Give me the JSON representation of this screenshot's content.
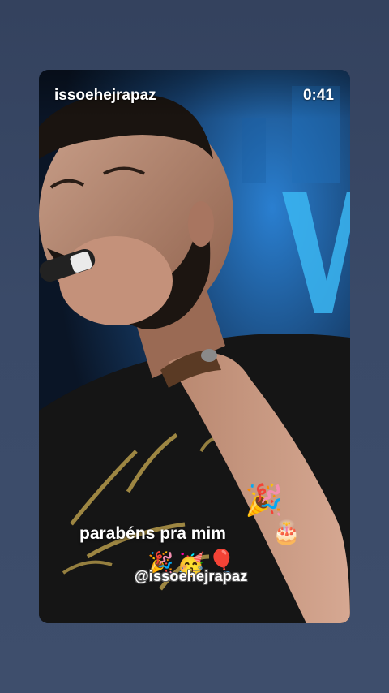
{
  "story": {
    "username": "issoehejrapaz",
    "duration": "0:41",
    "caption": "parabéns pra mim",
    "watermark": "@issoehejrapaz",
    "stickers": {
      "party_popper_top": "🎉",
      "birthday_cake": "🎂",
      "party_popper_bottom": "🎉",
      "party_face": "🥳",
      "balloon": "🎈"
    }
  },
  "colors": {
    "background": "#3a4a68",
    "stage_blue": "#2aa0e8",
    "shirt": "#141414",
    "shirt_print": "#b59a4a"
  }
}
